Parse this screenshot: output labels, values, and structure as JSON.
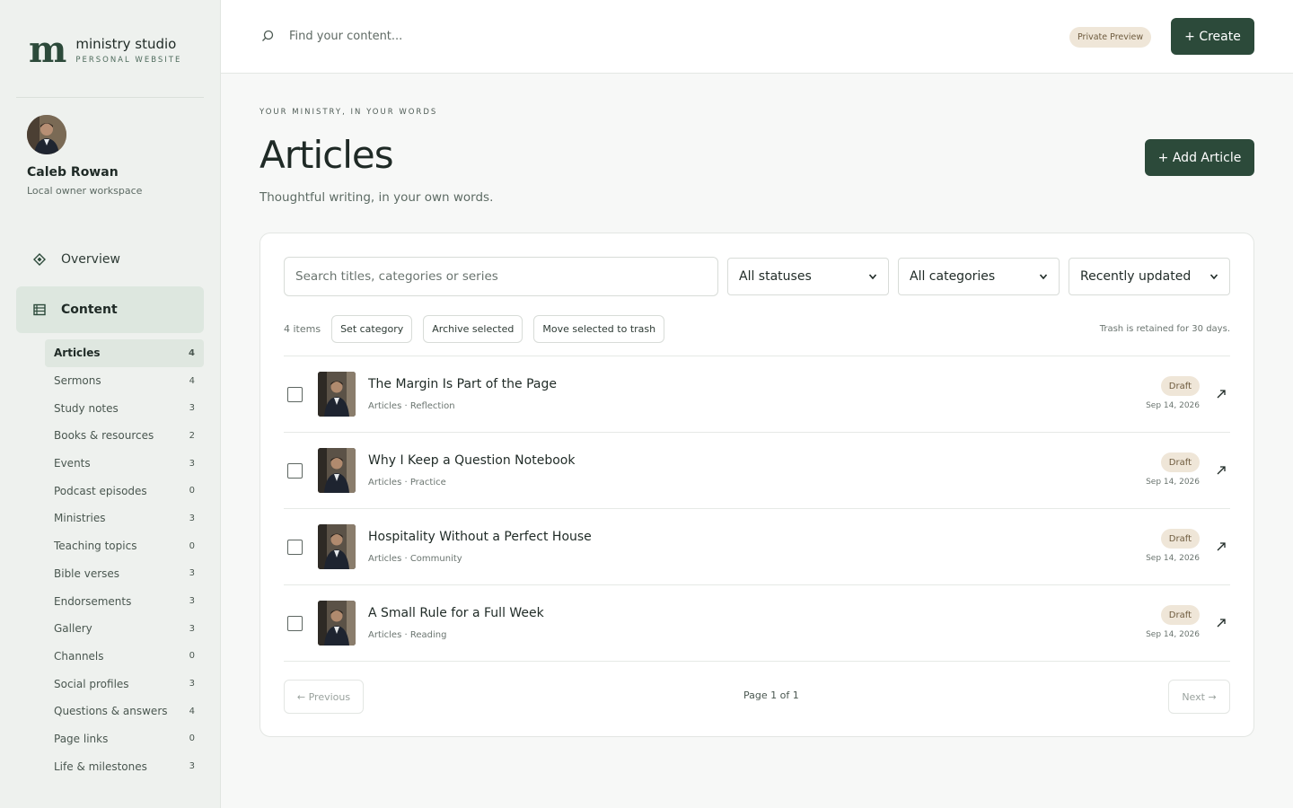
{
  "brand": {
    "mark": "m",
    "name": "ministry studio",
    "subtitle": "PERSONAL WEBSITE"
  },
  "user": {
    "name": "Caleb Rowan",
    "role": "Local owner workspace"
  },
  "nav": {
    "overview": {
      "label": "Overview",
      "icon": "diamond-icon"
    },
    "content": {
      "label": "Content",
      "icon": "list-icon"
    }
  },
  "content_items": [
    {
      "label": "Articles",
      "count": "4"
    },
    {
      "label": "Sermons",
      "count": "4"
    },
    {
      "label": "Study notes",
      "count": "3"
    },
    {
      "label": "Books & resources",
      "count": "2"
    },
    {
      "label": "Events",
      "count": "3"
    },
    {
      "label": "Podcast episodes",
      "count": "0"
    },
    {
      "label": "Ministries",
      "count": "3"
    },
    {
      "label": "Teaching topics",
      "count": "0"
    },
    {
      "label": "Bible verses",
      "count": "3"
    },
    {
      "label": "Endorsements",
      "count": "3"
    },
    {
      "label": "Gallery",
      "count": "3"
    },
    {
      "label": "Channels",
      "count": "0"
    },
    {
      "label": "Social profiles",
      "count": "3"
    },
    {
      "label": "Questions & answers",
      "count": "4"
    },
    {
      "label": "Page links",
      "count": "0"
    },
    {
      "label": "Life & milestones",
      "count": "3"
    }
  ],
  "topbar": {
    "search_placeholder": "Find your content...",
    "badge": "Private Preview",
    "create_label": "+ Create"
  },
  "header": {
    "eyebrow": "YOUR MINISTRY, IN YOUR WORDS",
    "title": "Articles",
    "subtitle": "Thoughtful writing, in your own words.",
    "add_label": "+ Add Article"
  },
  "filters": {
    "search_placeholder": "Search titles, categories or series",
    "status": "All statuses",
    "category": "All categories",
    "sort": "Recently updated"
  },
  "bulk": {
    "count": "4 items",
    "set_category": "Set category",
    "archive": "Archive selected",
    "trash": "Move selected to trash",
    "note": "Trash is retained for 30 days."
  },
  "articles": [
    {
      "title": "The Margin Is Part of the Page",
      "meta": "Articles · Reflection",
      "status": "Draft",
      "date": "Sep 14, 2026"
    },
    {
      "title": "Why I Keep a Question Notebook",
      "meta": "Articles · Practice",
      "status": "Draft",
      "date": "Sep 14, 2026"
    },
    {
      "title": "Hospitality Without a Perfect House",
      "meta": "Articles · Community",
      "status": "Draft",
      "date": "Sep 14, 2026"
    },
    {
      "title": "A Small Rule for a Full Week",
      "meta": "Articles · Reading",
      "status": "Draft",
      "date": "Sep 14, 2026"
    }
  ],
  "pager": {
    "prev": "← Previous",
    "info": "Page 1 of 1",
    "next": "Next →"
  },
  "colors": {
    "accent": "#2c4a3a",
    "badge_bg": "#efe6d8",
    "sidebar_bg": "#eef1ee"
  }
}
